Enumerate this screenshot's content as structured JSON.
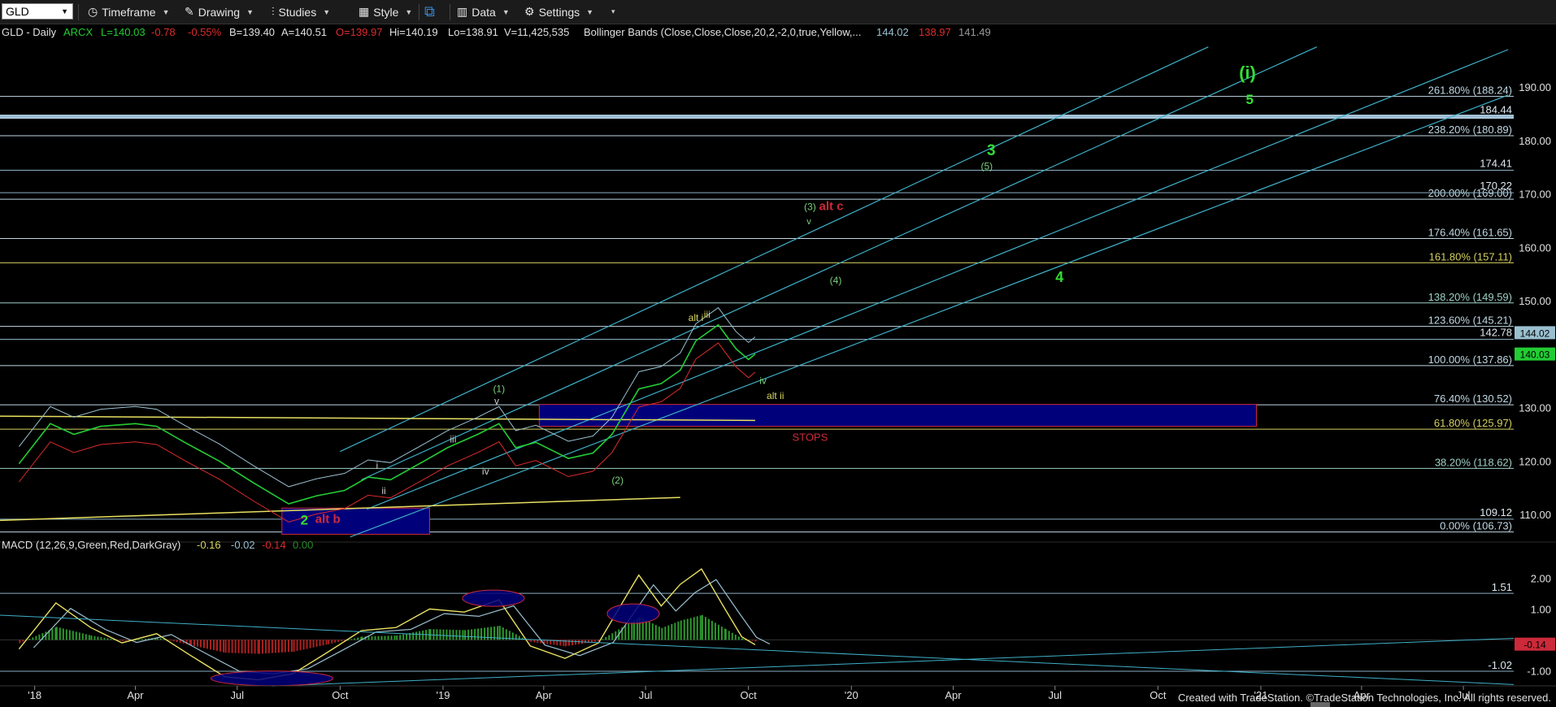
{
  "toolbar": {
    "symbol": "GLD",
    "timeframe": "Timeframe",
    "drawing": "Drawing",
    "studies": "Studies",
    "style": "Style",
    "data": "Data",
    "settings": "Settings"
  },
  "header": {
    "symbol_line": "GLD - Daily",
    "exchange": "ARCX",
    "last": "L=140.03",
    "change": "-0.78",
    "change_pct": "-0.55%",
    "bid": "B=139.40",
    "ask": "A=140.51",
    "open": "O=139.97",
    "high": "Hi=140.19",
    "low": "Lo=138.91",
    "volume": "V=11,425,535",
    "bb_label": "Bollinger Bands (Close,Close,Close,20,2,-2,0,true,Yellow,...",
    "bb_upper": "144.02",
    "bb_lower": "138.97",
    "bb_mid": "141.49"
  },
  "macd_header": {
    "label": "MACD (12,26,9,Green,Red,DarkGray)",
    "macd": "-0.16",
    "signal": "-0.02",
    "diff": "-0.14",
    "zero": "0.00"
  },
  "chart_data": {
    "type": "line",
    "title": "GLD - Daily",
    "x_ticks": [
      "'18",
      "Apr",
      "Jul",
      "Oct",
      "'19",
      "Apr",
      "Jul",
      "Oct",
      "'20",
      "Apr",
      "Jul",
      "Oct",
      "'21",
      "Apr",
      "Jul"
    ],
    "y_ticks": [
      110,
      120,
      130,
      140,
      150,
      160,
      170,
      180,
      190
    ],
    "ylim": [
      105,
      197
    ],
    "price_series": {
      "name": "GLD",
      "x": [
        "2017-12-18",
        "2018-01-15",
        "2018-02-05",
        "2018-03-01",
        "2018-04-01",
        "2018-04-20",
        "2018-05-15",
        "2018-06-15",
        "2018-07-15",
        "2018-08-16",
        "2018-09-10",
        "2018-10-05",
        "2018-10-26",
        "2018-11-15",
        "2018-12-15",
        "2019-01-05",
        "2019-02-01",
        "2019-02-20",
        "2019-03-07",
        "2019-03-25",
        "2019-04-23",
        "2019-05-15",
        "2019-06-01",
        "2019-06-25",
        "2019-07-15",
        "2019-08-01",
        "2019-08-15",
        "2019-09-04",
        "2019-09-20",
        "2019-10-01",
        "2019-10-07"
      ],
      "y": [
        119.5,
        127.0,
        125.0,
        126.5,
        127.0,
        126.5,
        123.5,
        120.0,
        116.0,
        112.0,
        113.5,
        114.5,
        117.0,
        116.5,
        120.0,
        122.5,
        125.0,
        127.0,
        122.5,
        123.5,
        120.5,
        121.5,
        125.0,
        133.5,
        134.5,
        137.0,
        142.5,
        145.5,
        141.0,
        139.0,
        140.03
      ]
    },
    "price_labels": [
      {
        "value": "184.44",
        "color": "#dde8f0"
      },
      {
        "value": "174.41",
        "color": "#dde8f0"
      },
      {
        "value": "170.22",
        "color": "#dde8f0"
      },
      {
        "value": "142.78",
        "color": "#dde8f0"
      },
      {
        "value": "109.12",
        "color": "#dde8f0"
      },
      {
        "value": "144.02",
        "color": "#9ac0d0"
      },
      {
        "value": "140.03",
        "color": "#22cc33"
      }
    ],
    "fib_levels": [
      {
        "label": "261.80% (188.24)",
        "value": 188.24,
        "color": "#c0d8e4"
      },
      {
        "label": "238.20% (180.89)",
        "value": 180.89,
        "color": "#c0d8e4"
      },
      {
        "label": "200.00% (169.00)",
        "value": 169.0,
        "color": "#c0d8e4"
      },
      {
        "label": "176.40% (161.65)",
        "value": 161.65,
        "color": "#c0d8e4"
      },
      {
        "label": "161.80% (157.11)",
        "value": 157.11,
        "color": "#d4d060"
      },
      {
        "label": "138.20% (149.59)",
        "value": 149.59,
        "color": "#9ed0c4"
      },
      {
        "label": "123.60% (145.21)",
        "value": 145.21,
        "color": "#c0d8e4"
      },
      {
        "label": "100.00% (137.86)",
        "value": 137.86,
        "color": "#c0d8e4"
      },
      {
        "label": "76.40% (130.52)",
        "value": 130.52,
        "color": "#c0d8e4"
      },
      {
        "label": "61.80% (125.97)",
        "value": 125.97,
        "color": "#d4d060"
      },
      {
        "label": "38.20% (118.62)",
        "value": 118.62,
        "color": "#9ed0c4"
      },
      {
        "label": "0.00% (106.73)",
        "value": 106.73,
        "color": "#c0d8e4"
      }
    ],
    "annotations": [
      {
        "text": "(i)",
        "color": "#33dd33"
      },
      {
        "text": "5",
        "color": "#33dd33"
      },
      {
        "text": "3",
        "color": "#33dd33"
      },
      {
        "text": "(5)",
        "color": "#7ad07a"
      },
      {
        "text": "(3)",
        "color": "#7ad07a"
      },
      {
        "text": "v",
        "color": "#7ad07a"
      },
      {
        "text": "alt c",
        "color": "#cc2a3a"
      },
      {
        "text": "(4)",
        "color": "#7ad07a"
      },
      {
        "text": "4",
        "color": "#33dd33"
      },
      {
        "text": "iii",
        "color": "#d8d860"
      },
      {
        "text": "alt i",
        "color": "#d8d860"
      },
      {
        "text": "iv",
        "color": "#7ad07a"
      },
      {
        "text": "alt ii",
        "color": "#d8d860"
      },
      {
        "text": "(1)",
        "color": "#7ad07a"
      },
      {
        "text": "v",
        "color": "#cccccc"
      },
      {
        "text": "iii",
        "color": "#cccccc"
      },
      {
        "text": "iv",
        "color": "#cccccc"
      },
      {
        "text": "(2)",
        "color": "#7ad07a"
      },
      {
        "text": "i",
        "color": "#cccccc"
      },
      {
        "text": "ii",
        "color": "#cccccc"
      },
      {
        "text": "2",
        "color": "#33dd33"
      },
      {
        "text": "alt b",
        "color": "#cc2a3a"
      },
      {
        "text": "STOPS",
        "color": "#cc2a3a"
      }
    ],
    "macd": {
      "y_ticks": [
        "2.00",
        "1.00",
        "-1.00"
      ],
      "price_labels": [
        {
          "value": "1.51",
          "color": "#dde8f0"
        },
        {
          "value": "-0.14",
          "color": "#cc2a3a"
        },
        {
          "value": "-1.02",
          "color": "#dde8f0"
        }
      ],
      "x": [
        "2017-12-18",
        "2018-01-20",
        "2018-02-20",
        "2018-03-20",
        "2018-04-20",
        "2018-05-20",
        "2018-06-20",
        "2018-07-20",
        "2018-08-20",
        "2018-09-20",
        "2018-10-20",
        "2018-11-20",
        "2018-12-20",
        "2019-01-20",
        "2019-02-20",
        "2019-03-20",
        "2019-04-20",
        "2019-05-20",
        "2019-06-20",
        "2019-06-25",
        "2019-07-15",
        "2019-08-01",
        "2019-08-20",
        "2019-09-10",
        "2019-09-25",
        "2019-10-07"
      ],
      "values": [
        -0.3,
        1.2,
        0.4,
        -0.1,
        0.2,
        -0.5,
        -1.2,
        -1.3,
        -1.1,
        -0.4,
        0.3,
        0.4,
        1.0,
        0.9,
        1.3,
        -0.2,
        -0.6,
        -0.1,
        1.8,
        2.1,
        1.1,
        1.8,
        2.3,
        1.0,
        0.1,
        -0.16
      ]
    }
  },
  "footer": "Created with TradeStation. ©TradeStation Technologies, Inc. All rights reserved."
}
